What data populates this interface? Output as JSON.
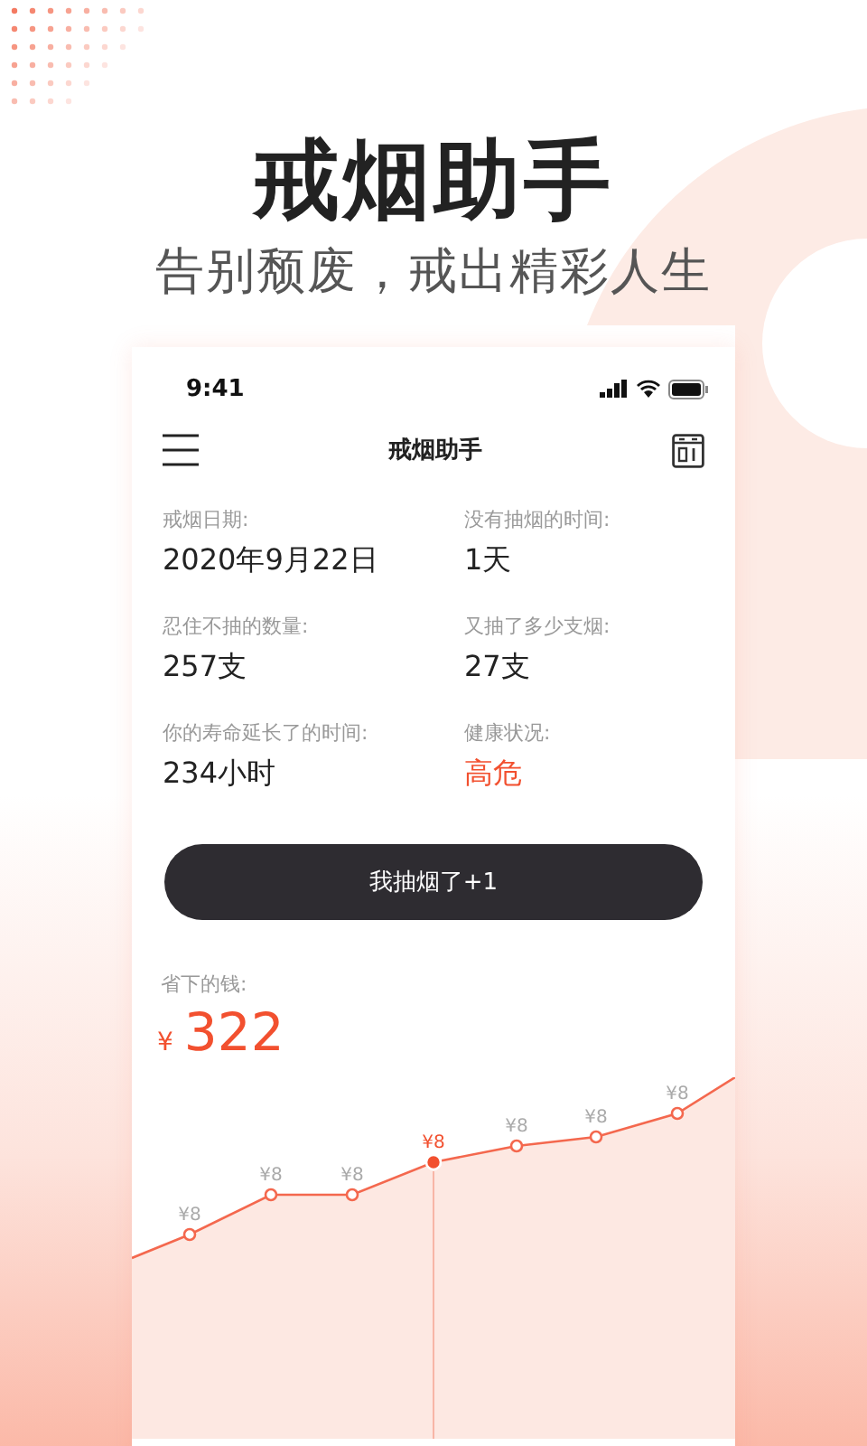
{
  "headline": {
    "title": "戒烟助手",
    "subtitle": "告别颓废，戒出精彩人生"
  },
  "status_bar": {
    "time": "9:41"
  },
  "app_bar": {
    "title": "戒烟助手"
  },
  "stats": [
    {
      "label": "戒烟日期:",
      "value": "2020年9月22日",
      "kind": "normal"
    },
    {
      "label": "没有抽烟的时间:",
      "value": "1天",
      "kind": "normal"
    },
    {
      "label": "忍住不抽的数量:",
      "value": "257支",
      "kind": "normal"
    },
    {
      "label": "又抽了多少支烟:",
      "value": "27支",
      "kind": "normal"
    },
    {
      "label": "你的寿命延长了的时间:",
      "value": "234小时",
      "kind": "normal"
    },
    {
      "label": "健康状况:",
      "value": "高危",
      "kind": "alert"
    }
  ],
  "smoke_button": "我抽烟了+1",
  "savings": {
    "label": "省下的钱:",
    "currency": "¥",
    "amount": "322"
  },
  "trend_points": [
    {
      "label": "¥8",
      "selected": false
    },
    {
      "label": "¥8",
      "selected": false
    },
    {
      "label": "¥8",
      "selected": false
    },
    {
      "label": "¥8",
      "selected": true
    },
    {
      "label": "¥8",
      "selected": false
    },
    {
      "label": "¥8",
      "selected": false
    },
    {
      "label": "¥8",
      "selected": false
    }
  ]
}
